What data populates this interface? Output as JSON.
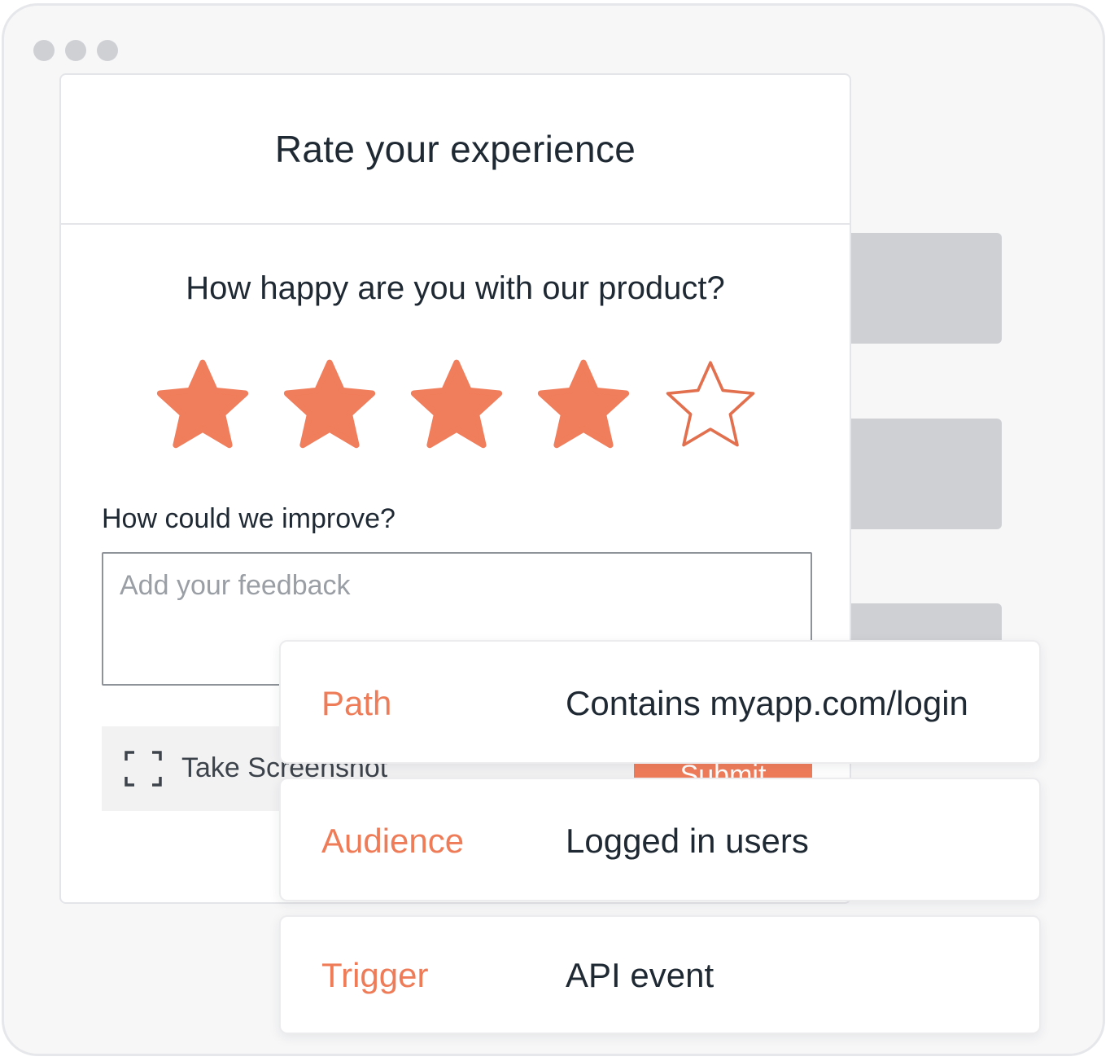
{
  "window": {
    "controls": [
      "dot",
      "dot",
      "dot"
    ]
  },
  "survey": {
    "title": "Rate your experience",
    "question": "How happy are you with our product?",
    "rating": {
      "value": 4,
      "max": 5
    },
    "improve_label": "How could we improve?",
    "feedback_placeholder": "Add your feedback",
    "screenshot_label": "Take Screenshot",
    "submit_label": "Submit",
    "accent_color": "#f07d5b"
  },
  "targeting": [
    {
      "key": "Path",
      "value": "Contains myapp.com/login"
    },
    {
      "key": "Audience",
      "value": "Logged in users"
    },
    {
      "key": "Trigger",
      "value": "API event"
    }
  ]
}
